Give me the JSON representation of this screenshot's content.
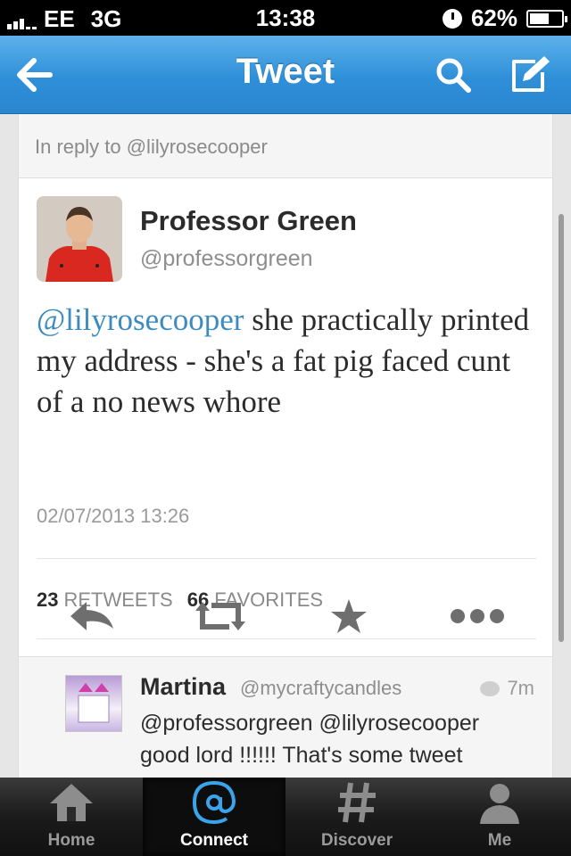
{
  "status_bar": {
    "carrier": "EE",
    "network": "3G",
    "time": "13:38",
    "battery": "62%",
    "battery_level": 0.62
  },
  "nav": {
    "title": "Tweet",
    "back_icon": "back-arrow-icon",
    "search_icon": "search-icon",
    "compose_icon": "compose-icon"
  },
  "reply_context": "In reply to @lilyrosecooper",
  "tweet": {
    "name": "Professor Green",
    "handle": "@professorgreen",
    "mention": "@lilyrosecooper",
    "text": " she practically printed my address - she's a fat pig faced cunt of a no news whore",
    "timestamp": "02/07/2013 13:26",
    "retweets_count": "23",
    "retweets_label": "RETWEETS",
    "favorites_count": "66",
    "favorites_label": "FAVORITES"
  },
  "reply": {
    "name": "Martina",
    "handle": "@mycraftycandles",
    "time": "7m",
    "text": "@professorgreen @lilyrosecooper good lord !!!!!! That's some tweet"
  },
  "tabs": [
    {
      "label": "Home",
      "icon": "home-icon"
    },
    {
      "label": "Connect",
      "icon": "at-sign-icon"
    },
    {
      "label": "Discover",
      "icon": "hashtag-icon"
    },
    {
      "label": "Me",
      "icon": "person-icon"
    }
  ],
  "colors": {
    "nav_blue": "#2e8fd8",
    "mention_blue": "#3b8bbf"
  }
}
